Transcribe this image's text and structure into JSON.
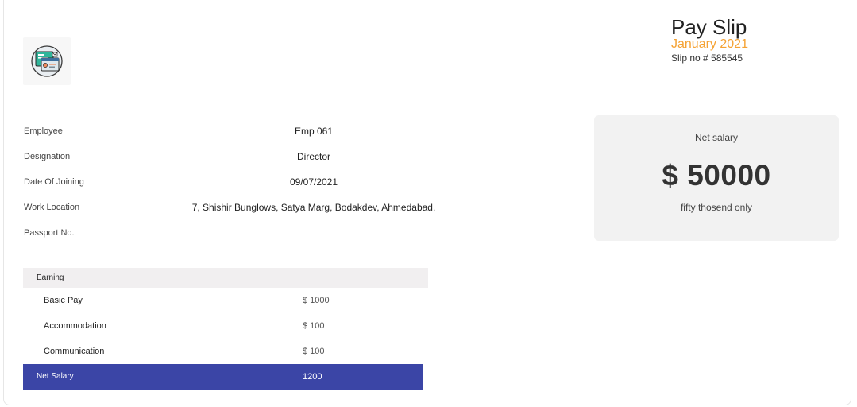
{
  "header": {
    "title": "Pay Slip",
    "month": "January 2021",
    "slip_no": "Slip no # 585545"
  },
  "logo": {
    "icon": "payslip-document-icon"
  },
  "employee_info": [
    {
      "label": "Employee",
      "value": "Emp 061"
    },
    {
      "label": "Designation",
      "value": "Director"
    },
    {
      "label": "Date Of Joining",
      "value": "09/07/2021"
    },
    {
      "label": "Work Location",
      "value": "7, Shishir Bunglows, Satya Marg, Bodakdev, Ahmedabad,"
    },
    {
      "label": "Passport No.",
      "value": ""
    }
  ],
  "net_salary_box": {
    "label": "Net salary",
    "amount": "$ 50000",
    "words": "fifty thosend only"
  },
  "earnings": {
    "header": "Earning",
    "rows": [
      {
        "name": "Basic Pay",
        "value": "$ 1000"
      },
      {
        "name": "Accommodation",
        "value": "$ 100"
      },
      {
        "name": "Communication",
        "value": "$ 100"
      }
    ],
    "total": {
      "name": "Net Salary",
      "value": "1200"
    }
  },
  "colors": {
    "accent_orange": "#f5a233",
    "net_row_blue": "#3b45a6",
    "panel_gray": "#f2f2f2"
  }
}
